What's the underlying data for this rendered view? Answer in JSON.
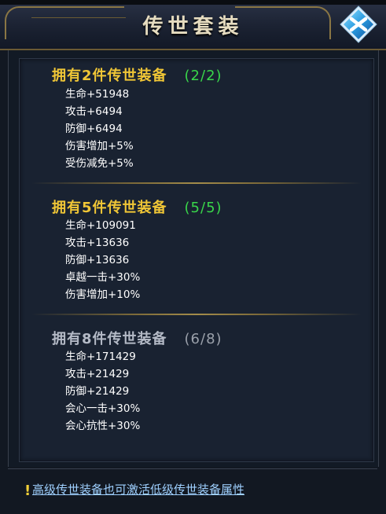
{
  "title": "传世套装",
  "close_icon": "close-x-icon",
  "sets": [
    {
      "title": "拥有2件传世装备",
      "count": "(2/2)",
      "active": true,
      "attrs": [
        "生命+51948",
        "攻击+6494",
        "防御+6494",
        "伤害增加+5%",
        "受伤减免+5%"
      ]
    },
    {
      "title": "拥有5件传世装备",
      "count": "(5/5)",
      "active": true,
      "attrs": [
        "生命+109091",
        "攻击+13636",
        "防御+13636",
        "卓越一击+30%",
        "伤害增加+10%"
      ]
    },
    {
      "title": "拥有8件传世装备",
      "count": "(6/8)",
      "active": false,
      "attrs": [
        "生命+171429",
        "攻击+21429",
        "防御+21429",
        "会心一击+30%",
        "会心抗性+30%"
      ]
    }
  ],
  "tip": {
    "icon": "exclamation-icon",
    "text": "高级传世装备也可激活低级传世装备属性"
  },
  "colors": {
    "active_title": "#f0c636",
    "active_count": "#39d64a",
    "inactive_title": "#b4bac6",
    "attr_text": "#ffffff",
    "tip_link": "#9fd0ff"
  }
}
